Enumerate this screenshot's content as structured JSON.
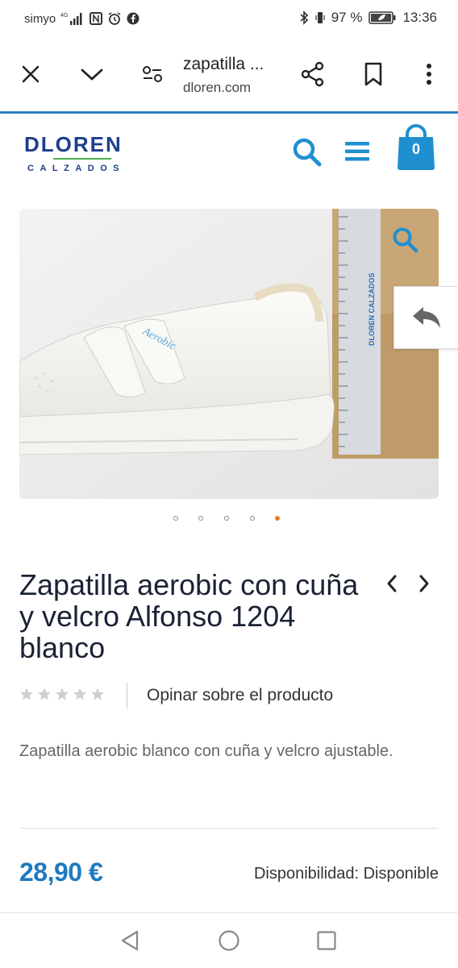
{
  "statusbar": {
    "carrier": "simyo",
    "network": "4G",
    "battery": "97 %",
    "time": "13:36"
  },
  "browser": {
    "title": "zapatilla ...",
    "url": "dloren.com"
  },
  "site": {
    "logo_main": "DLOREN",
    "logo_sub": "CALZADOS",
    "cart_count": "0",
    "brand_color": "#1d3f8a",
    "accent_color": "#1f8fd0"
  },
  "product": {
    "image_text_ruler": "DLOREN CALZADOS",
    "image_text_shoe": "Aerobic",
    "carousel": {
      "total": 5,
      "active_index": 4
    },
    "title": "Zapatilla aerobic con cuña y velcro Alfonso 1204 blanco",
    "rating": {
      "value": 0,
      "max": 5
    },
    "review_link": "Opinar sobre el producto",
    "description": "Zapatilla aerobic blanco con cuña y velcro ajustable.",
    "price": "28,90 €",
    "availability": "Disponibilidad: Disponible"
  },
  "icons": {
    "close": "close-icon",
    "dropdown": "chevron-down-icon",
    "page_settings": "tune-icon",
    "share": "share-icon",
    "bookmark": "bookmark-icon",
    "menu": "more-vert-icon",
    "search": "search-icon",
    "hamburger": "hamburger-icon",
    "cart": "shopping-bag-icon",
    "zoom": "zoom-icon",
    "back": "reply-icon"
  }
}
